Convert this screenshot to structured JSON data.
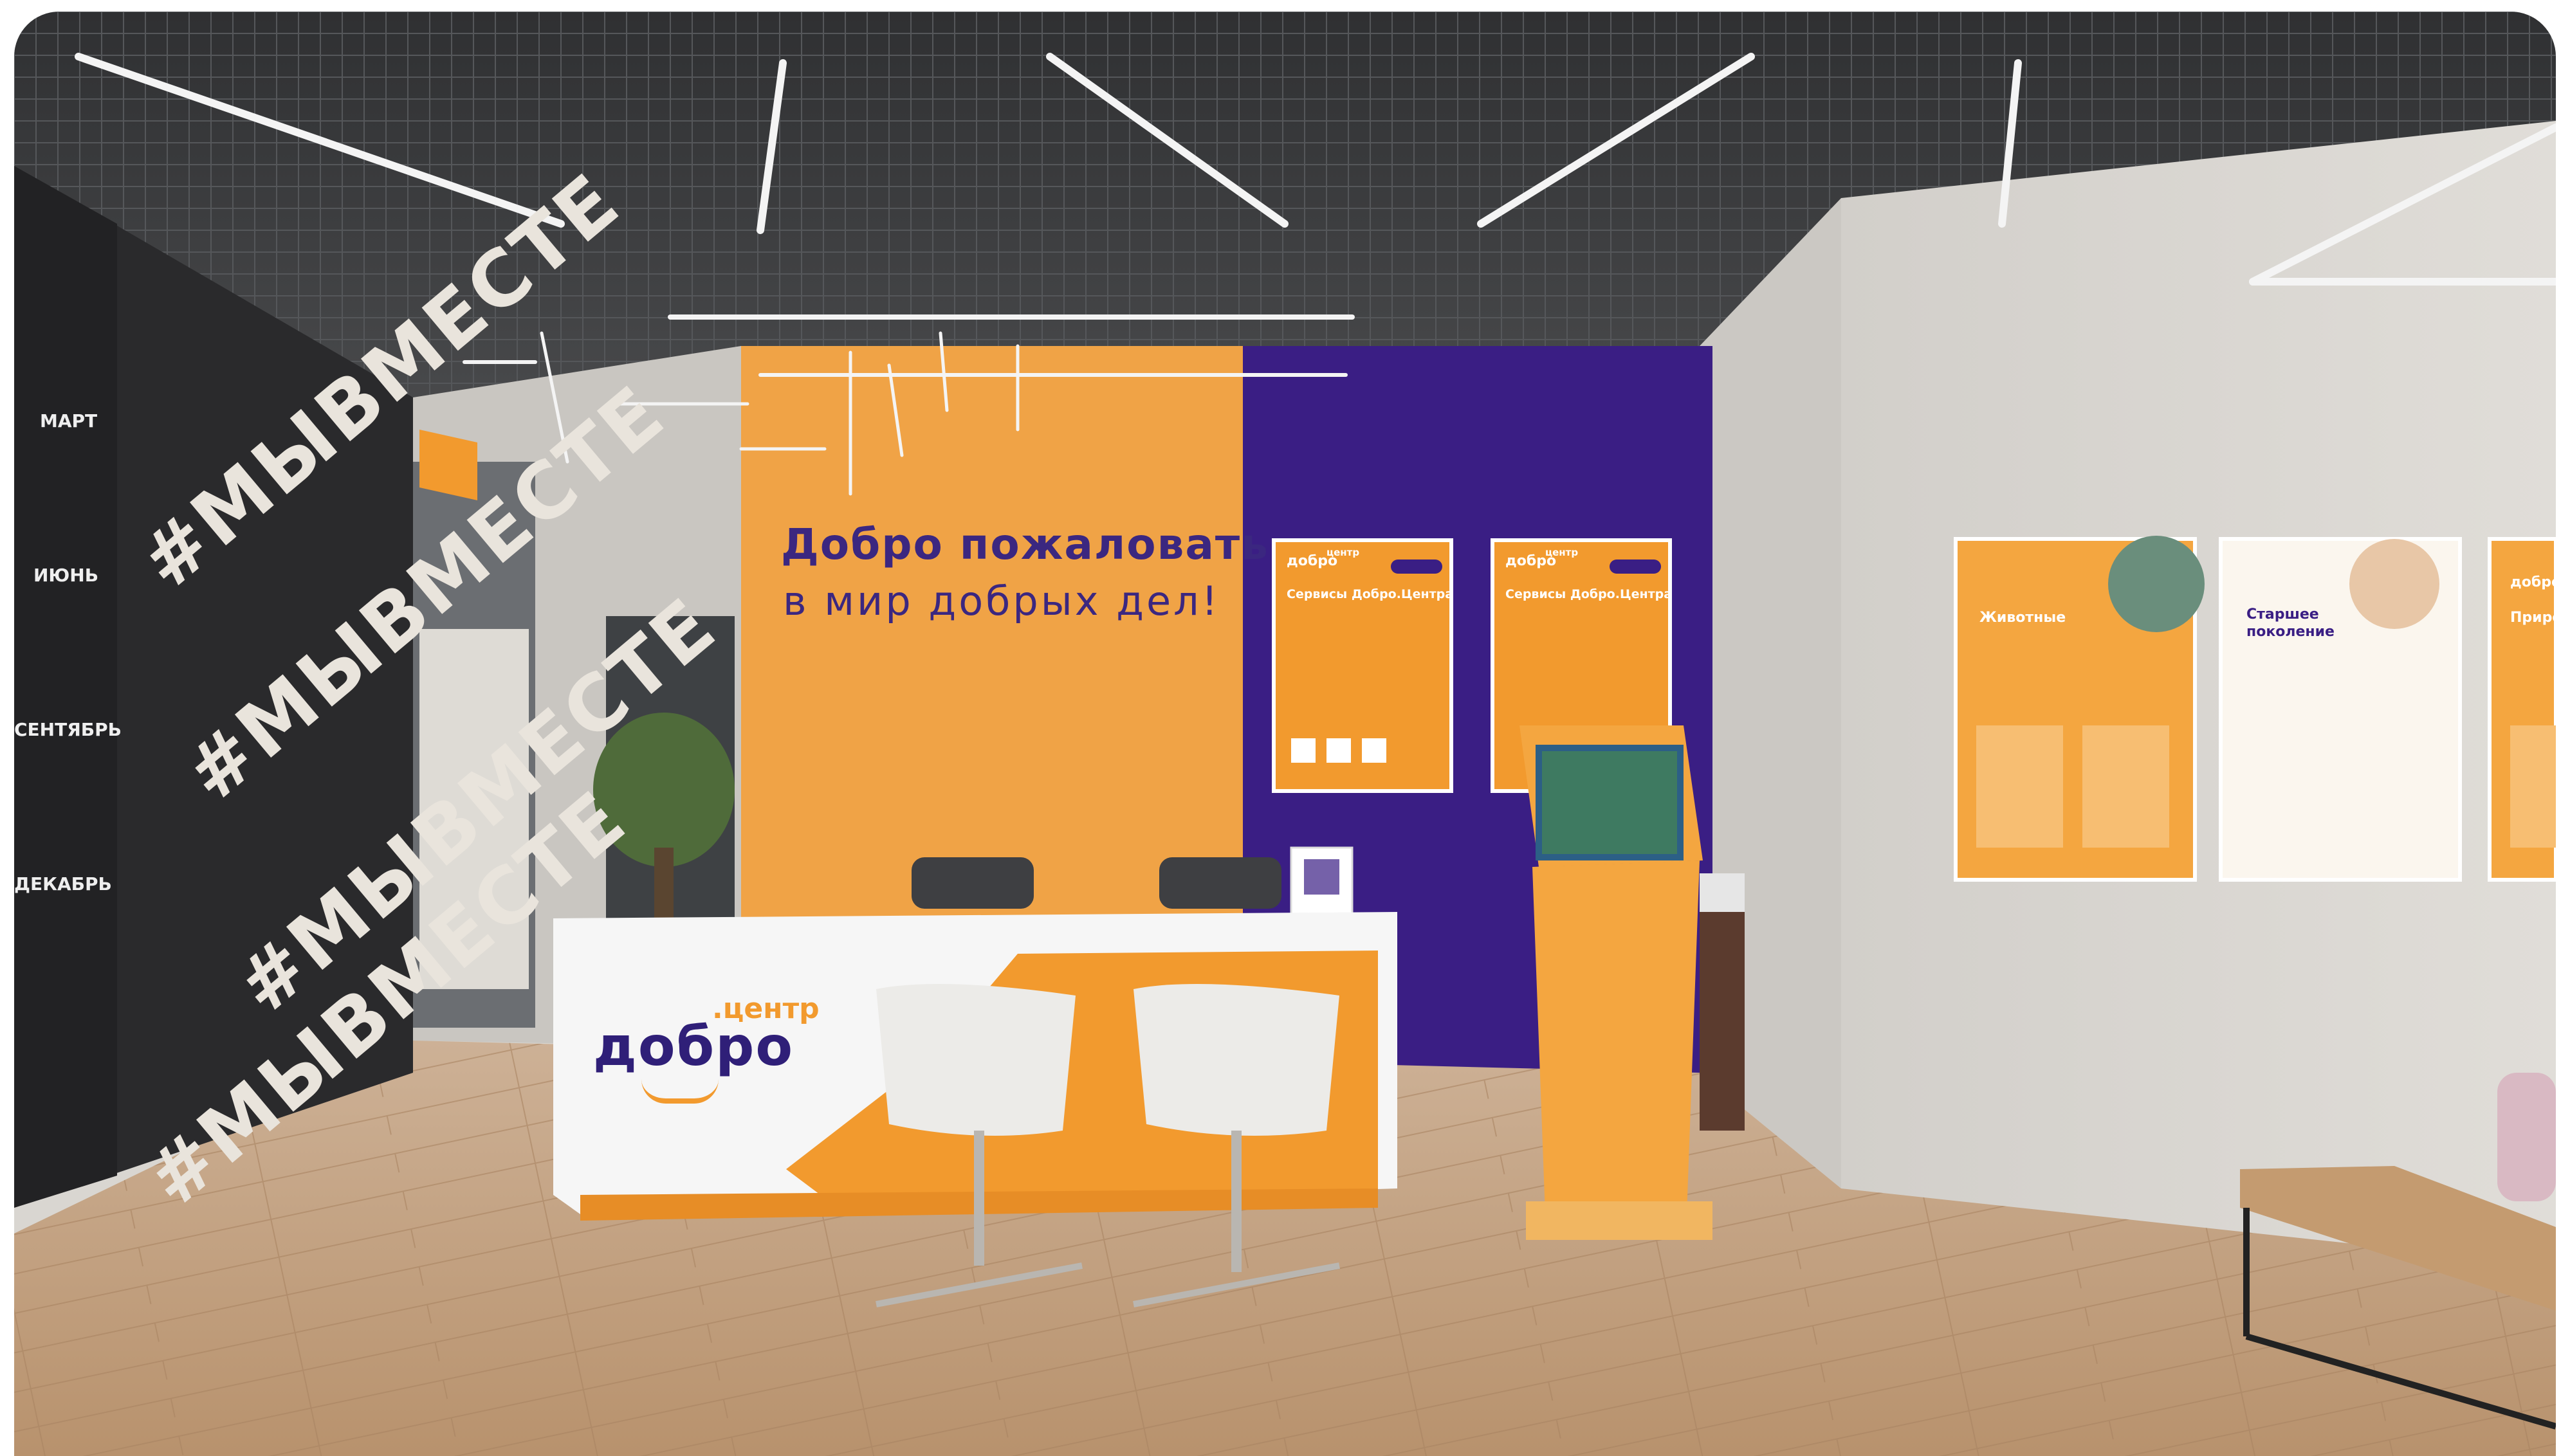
{
  "welcome": {
    "line1": "Добро пожаловать",
    "line2": "в мир добрых дел!"
  },
  "desk_brand": {
    "main": "добро",
    "sub": ".центр"
  },
  "posters": {
    "left": {
      "brand": "добро",
      "brand_sub": "центр",
      "title": "Сервисы Добро.Центра"
    },
    "right": {
      "brand": "добро",
      "brand_sub": "центр",
      "title": "Сервисы Добро.Центра"
    }
  },
  "categories": {
    "animals": "Животные",
    "elderly_line1": "Старшее",
    "elderly_line2": "поколение",
    "nature": "Природа",
    "nature_brand": "добро"
  },
  "calendar": {
    "months": [
      "МАРТ",
      "ИЮНЬ",
      "СЕНТЯБРЬ",
      "ДЕКАБРЬ"
    ]
  },
  "slogan": "#МЫВМЕСТЕ",
  "colors": {
    "brand_orange": "#f29a2e",
    "brand_purple": "#3b2780",
    "ceiling": "#3a3b3d",
    "wall_concrete": "#d8d5d0",
    "floor_wood": "#c9a989",
    "graffiti_wall": "#2b2b2d"
  }
}
